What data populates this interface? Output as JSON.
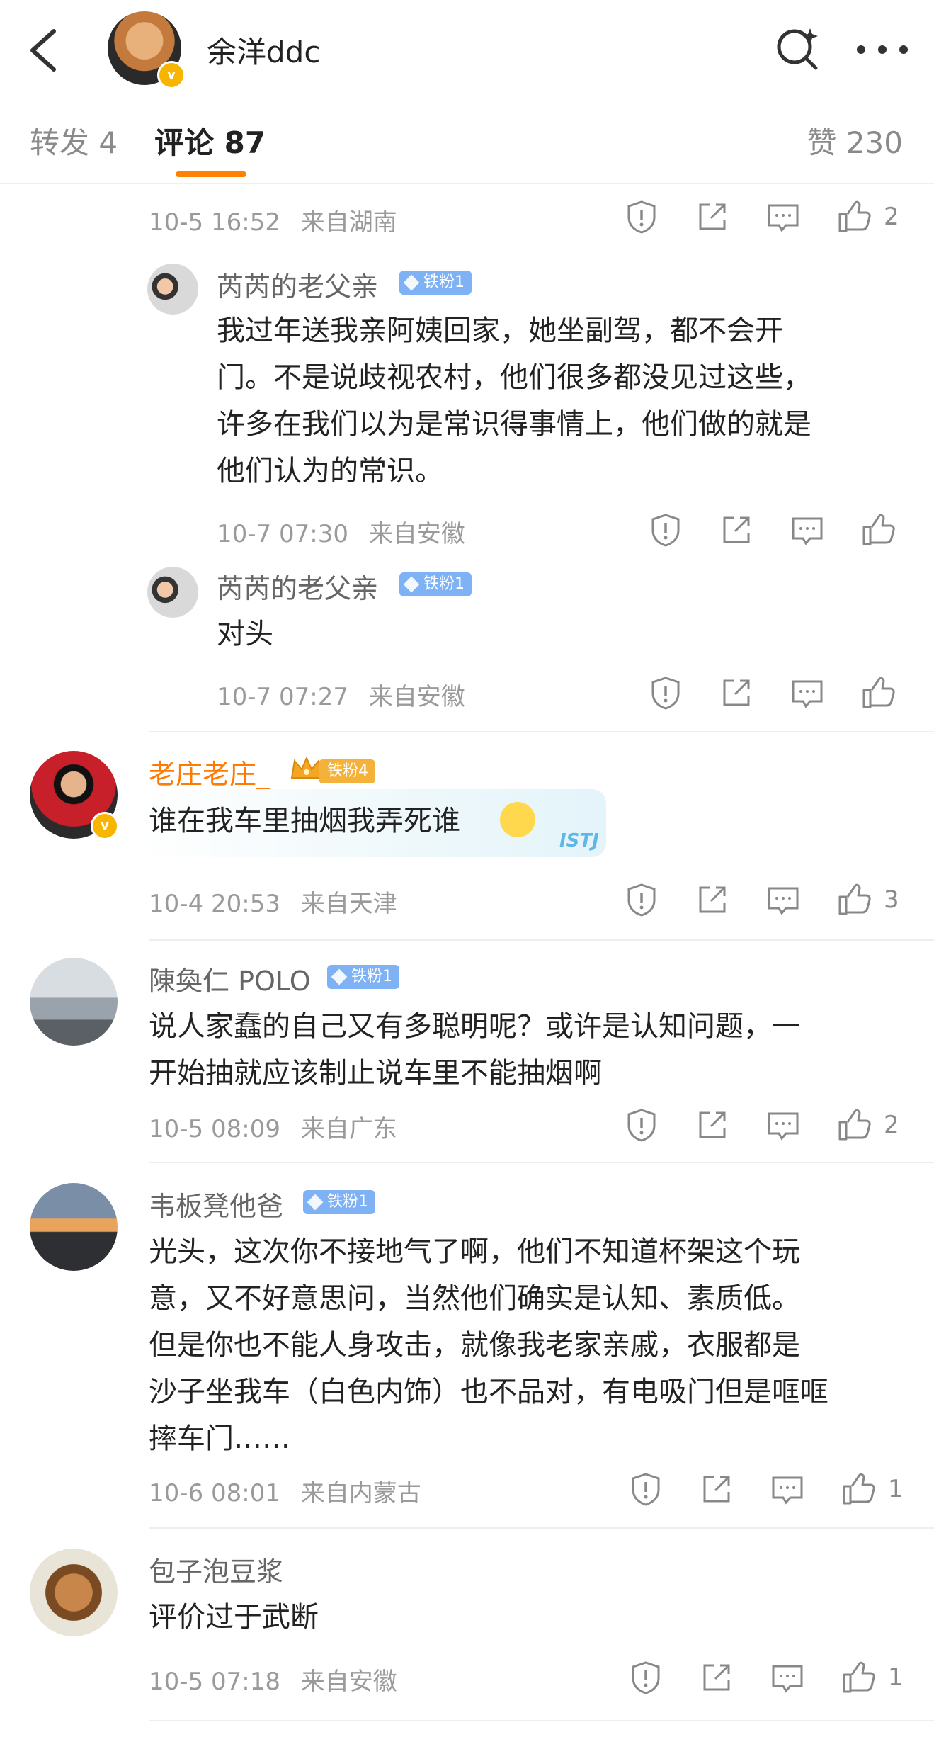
{
  "header": {
    "title": "余洋ddc"
  },
  "tabs": {
    "repost": "转发 4",
    "comment": "评论 87",
    "likes": "赞 230"
  },
  "top_meta": {
    "time": "10-5 16:52",
    "location": "来自湖南",
    "like_count": "2"
  },
  "sub_replies": [
    {
      "name": "芮芮的老父亲",
      "badge": "铁粉1",
      "text_lines": [
        "我过年送我亲阿姨回家，她坐副驾，都不会开",
        "门。不是说歧视农村，他们很多都没见过这些，",
        "许多在我们以为是常识得事情上，他们做的就是",
        "他们认为的常识。"
      ],
      "time": "10-7 07:30",
      "location": "来自安徽"
    },
    {
      "name": "芮芮的老父亲",
      "badge": "铁粉1",
      "text_lines": [
        "对头"
      ],
      "time": "10-7 07:27",
      "location": "来自安徽"
    }
  ],
  "comments": [
    {
      "name": "老庄老庄_",
      "badge": "铁粉4",
      "text_lines": [
        "谁在我车里抽烟我弄死谁"
      ],
      "sticker_text": "ISTJ",
      "time": "10-4 20:53",
      "location": "来自天津",
      "like_count": "3"
    },
    {
      "name": "陳奐仁 POLO",
      "badge": "铁粉1",
      "text_lines": [
        "说人家蠢的自己又有多聪明呢？或许是认知问题，一",
        "开始抽就应该制止说车里不能抽烟啊"
      ],
      "time": "10-5 08:09",
      "location": "来自广东",
      "like_count": "2"
    },
    {
      "name": "韦板凳他爸",
      "badge": "铁粉1",
      "text_lines": [
        "光头，这次你不接地气了啊，他们不知道杯架这个玩",
        "意，又不好意思问，当然他们确实是认知、素质低。",
        "但是你也不能人身攻击，就像我老家亲戚，衣服都是",
        "沙子坐我车（白色内饰）也不品对，有电吸门但是哐哐",
        "摔车门……"
      ],
      "time": "10-6 08:01",
      "location": "来自内蒙古",
      "like_count": "1"
    },
    {
      "name": "包子泡豆浆",
      "badge": "",
      "text_lines": [
        "评价过于武断"
      ],
      "time": "10-5 07:18",
      "location": "来自安徽",
      "like_count": "1"
    }
  ],
  "colors": {
    "accent": "#ff8200",
    "orange_name": "#ff7a00",
    "fan_badge": "#7fb2f5",
    "verified": "#f7b500"
  },
  "icons": [
    "back-arrow-icon",
    "search-sparkle-icon",
    "more-icon",
    "report-icon",
    "share-icon",
    "comment-icon",
    "like-icon"
  ]
}
